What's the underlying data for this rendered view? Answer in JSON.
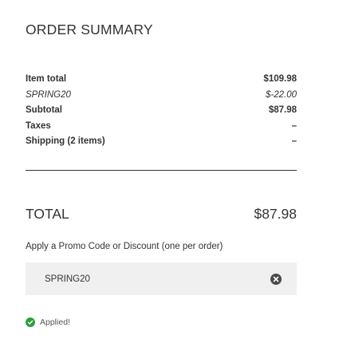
{
  "summary": {
    "title": "ORDER SUMMARY",
    "lines": [
      {
        "label": "Item total",
        "amount": "$109.98"
      },
      {
        "label": "SPRING20",
        "amount": "$-22.00"
      },
      {
        "label": "Subtotal",
        "amount": "$87.98"
      },
      {
        "label": "Taxes",
        "amount": "–"
      },
      {
        "label": "Shipping (2 items)",
        "amount": "–"
      }
    ],
    "total_label": "TOTAL",
    "total_amount": "$87.98"
  },
  "promo": {
    "label": "Apply a Promo Code or Discount (one per order)",
    "code": "SPRING20",
    "clear_icon": "close-circle-icon",
    "status": "Applied!",
    "status_icon": "check-circle-icon",
    "status_color": "#2e9e3e"
  }
}
